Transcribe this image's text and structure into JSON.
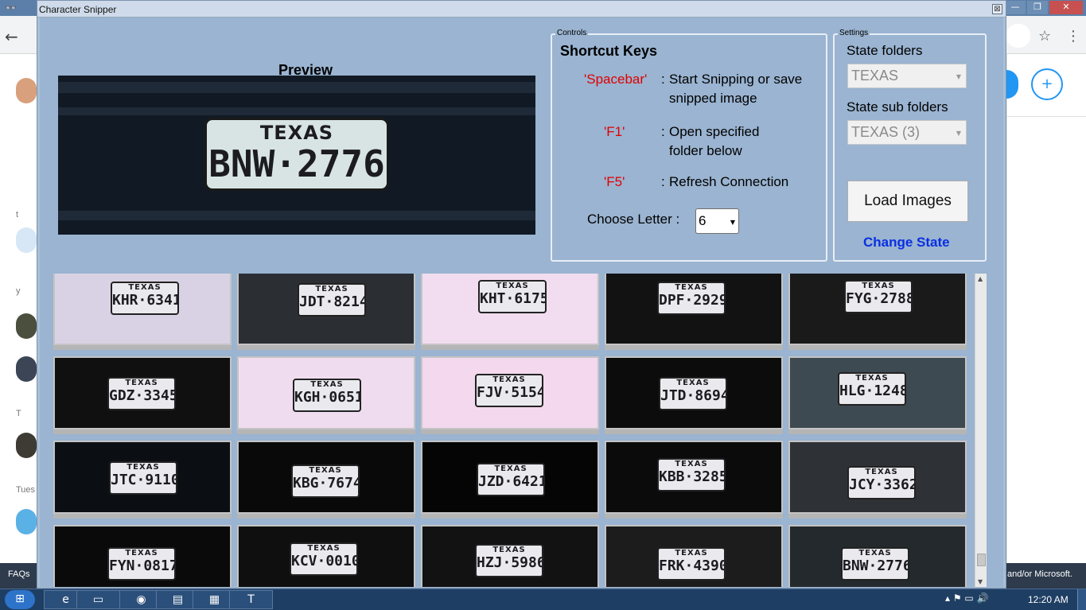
{
  "window": {
    "title": "Character Snipper",
    "close_glyph": "⊠"
  },
  "preview": {
    "title": "Preview",
    "plate_state": "TEXAS",
    "plate_number": "BNW·2776"
  },
  "controls": {
    "legend": "Controls",
    "shortcut_title": "Shortcut Keys",
    "shortcuts": [
      {
        "key": "'Spacebar'",
        "colon": ":",
        "desc": "Start Snipping or save snipped image"
      },
      {
        "key": "'F1'",
        "colon": ":",
        "desc": "Open specified folder below"
      },
      {
        "key": "'F5'",
        "colon": ":",
        "desc": "Refresh Connection"
      }
    ],
    "choose_letter_label": "Choose Letter :",
    "letter_value": "6",
    "dropdown_glyph": "▼"
  },
  "settings": {
    "legend": "Settings",
    "state_folders_label": "State folders",
    "state_folders_value": "TEXAS",
    "state_sub_label": "State sub folders",
    "state_sub_value": "TEXAS (3)",
    "load_images_label": "Load Images",
    "change_state_label": "Change State",
    "dropdown_glyph": "▼"
  },
  "thumbnails": [
    {
      "number": "KHR·6341",
      "state": "TEXAS",
      "scene_color": "#d9d2e4"
    },
    {
      "number": "JDT·8214",
      "state": "TEXAS",
      "scene_color": "#2b2f33"
    },
    {
      "number": "KHT·6175",
      "state": "TEXAS",
      "scene_color": "#f2dcef"
    },
    {
      "number": "DPF·2929",
      "state": "TEXAS",
      "scene_color": "#121212"
    },
    {
      "number": "FYG·2788",
      "state": "TEXAS",
      "scene_color": "#1a1a1a"
    },
    {
      "number": "GDZ·3345",
      "state": "TEXAS",
      "scene_color": "#101010"
    },
    {
      "number": "KGH·0651",
      "state": "TEXAS",
      "scene_color": "#f0dcef"
    },
    {
      "number": "FJV·5154",
      "state": "TEXAS",
      "scene_color": "#f3d8ee"
    },
    {
      "number": "JTD·8694",
      "state": "TEXAS",
      "scene_color": "#0c0c0c"
    },
    {
      "number": "HLG·1248",
      "state": "TEXAS",
      "scene_color": "#3e4a52"
    },
    {
      "number": "JTC·9110",
      "state": "TEXAS",
      "scene_color": "#0b0f14"
    },
    {
      "number": "KBG·7674",
      "state": "TEXAS",
      "scene_color": "#090909"
    },
    {
      "number": "JZD·6421",
      "state": "TEXAS",
      "scene_color": "#050505"
    },
    {
      "number": "KBB·3285",
      "state": "TEXAS",
      "scene_color": "#0b0b0b"
    },
    {
      "number": "JCY·3362",
      "state": "TEXAS",
      "scene_color": "#2e3236"
    },
    {
      "number": "FYN·0817",
      "state": "TEXAS",
      "scene_color": "#0a0a0a"
    },
    {
      "number": "KCV·0010",
      "state": "TEXAS",
      "scene_color": "#0f0f0f"
    },
    {
      "number": "HZJ·5986",
      "state": "TEXAS",
      "scene_color": "#121212"
    },
    {
      "number": "FRK·4390",
      "state": "TEXAS",
      "scene_color": "#1c1c1c"
    },
    {
      "number": "BNW·2776",
      "state": "TEXAS",
      "scene_color": "#24292d"
    }
  ],
  "scrollbar": {
    "up_glyph": "▲",
    "down_glyph": "▼"
  },
  "background_browser": {
    "incognito_icon": "incognito-icon",
    "back_glyph": "←",
    "star_glyph": "☆",
    "menu_glyph": "⋮",
    "adduser_glyph": "+",
    "faq_text": "FAQs",
    "microsoft_text": "and/or Microsoft.",
    "win_min": "—",
    "win_restore": "❐",
    "win_close": "✕",
    "incognito_glyph": "👓",
    "left_letters": [
      "t",
      "y",
      "T",
      "Tues"
    ]
  },
  "taskbar": {
    "start_glyph": "⊞",
    "items": [
      {
        "name": "ie",
        "glyph": "e"
      },
      {
        "name": "explorer",
        "glyph": "▭"
      },
      {
        "name": "chrome",
        "glyph": "◉"
      },
      {
        "name": "folders",
        "glyph": "▤"
      },
      {
        "name": "calculator",
        "glyph": "▦"
      },
      {
        "name": "app",
        "glyph": "T"
      }
    ],
    "tray_glyphs": "▴  ⚑  ▭  🔊",
    "clock": "12:20 AM"
  }
}
